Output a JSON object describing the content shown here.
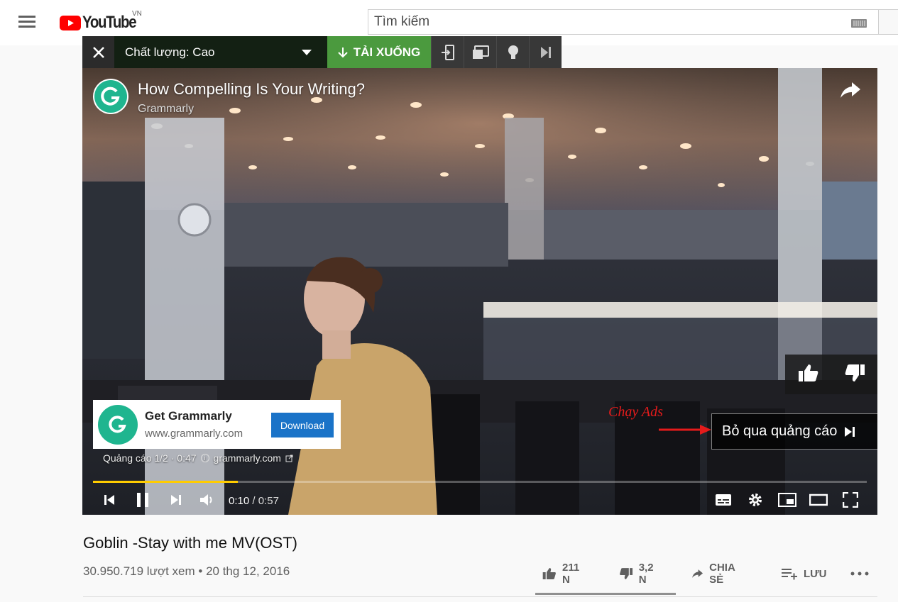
{
  "masthead": {
    "logo_text": "YouTube",
    "country_code": "VN",
    "search_placeholder": "Tìm kiếm",
    "brand_red": "#ff0000"
  },
  "downloader": {
    "quality_label": "Chất lượng: Cao",
    "download_label": "TẢI XUỐNG",
    "download_color": "#4b9a3e",
    "tools": [
      "exit-icon",
      "picture-in-picture-icon",
      "lightbulb-icon",
      "skip-icon"
    ]
  },
  "player": {
    "ad_title": "How Compelling Is Your Writing?",
    "ad_channel": "Grammarly",
    "ad_card": {
      "title": "Get Grammarly",
      "url": "www.grammarly.com",
      "button": "Download"
    },
    "ad_info_prefix": "Quảng cáo 1/2 · 0:47",
    "ad_info_domain": "grammarly.com",
    "annotation": "Chạy Ads",
    "skip_label": "Bỏ qua quảng cáo",
    "current_time": "0:10",
    "duration": "0:57",
    "progress_fraction": 0.187,
    "progress_color": "#ffcc00"
  },
  "video": {
    "title": "Goblin -Stay with me MV(OST)",
    "meta": "30.950.719 lượt xem • 20 thg 12, 2016",
    "likes": "211 N",
    "dislikes": "3,2 N",
    "share": "CHIA SẺ",
    "save": "LƯU"
  }
}
